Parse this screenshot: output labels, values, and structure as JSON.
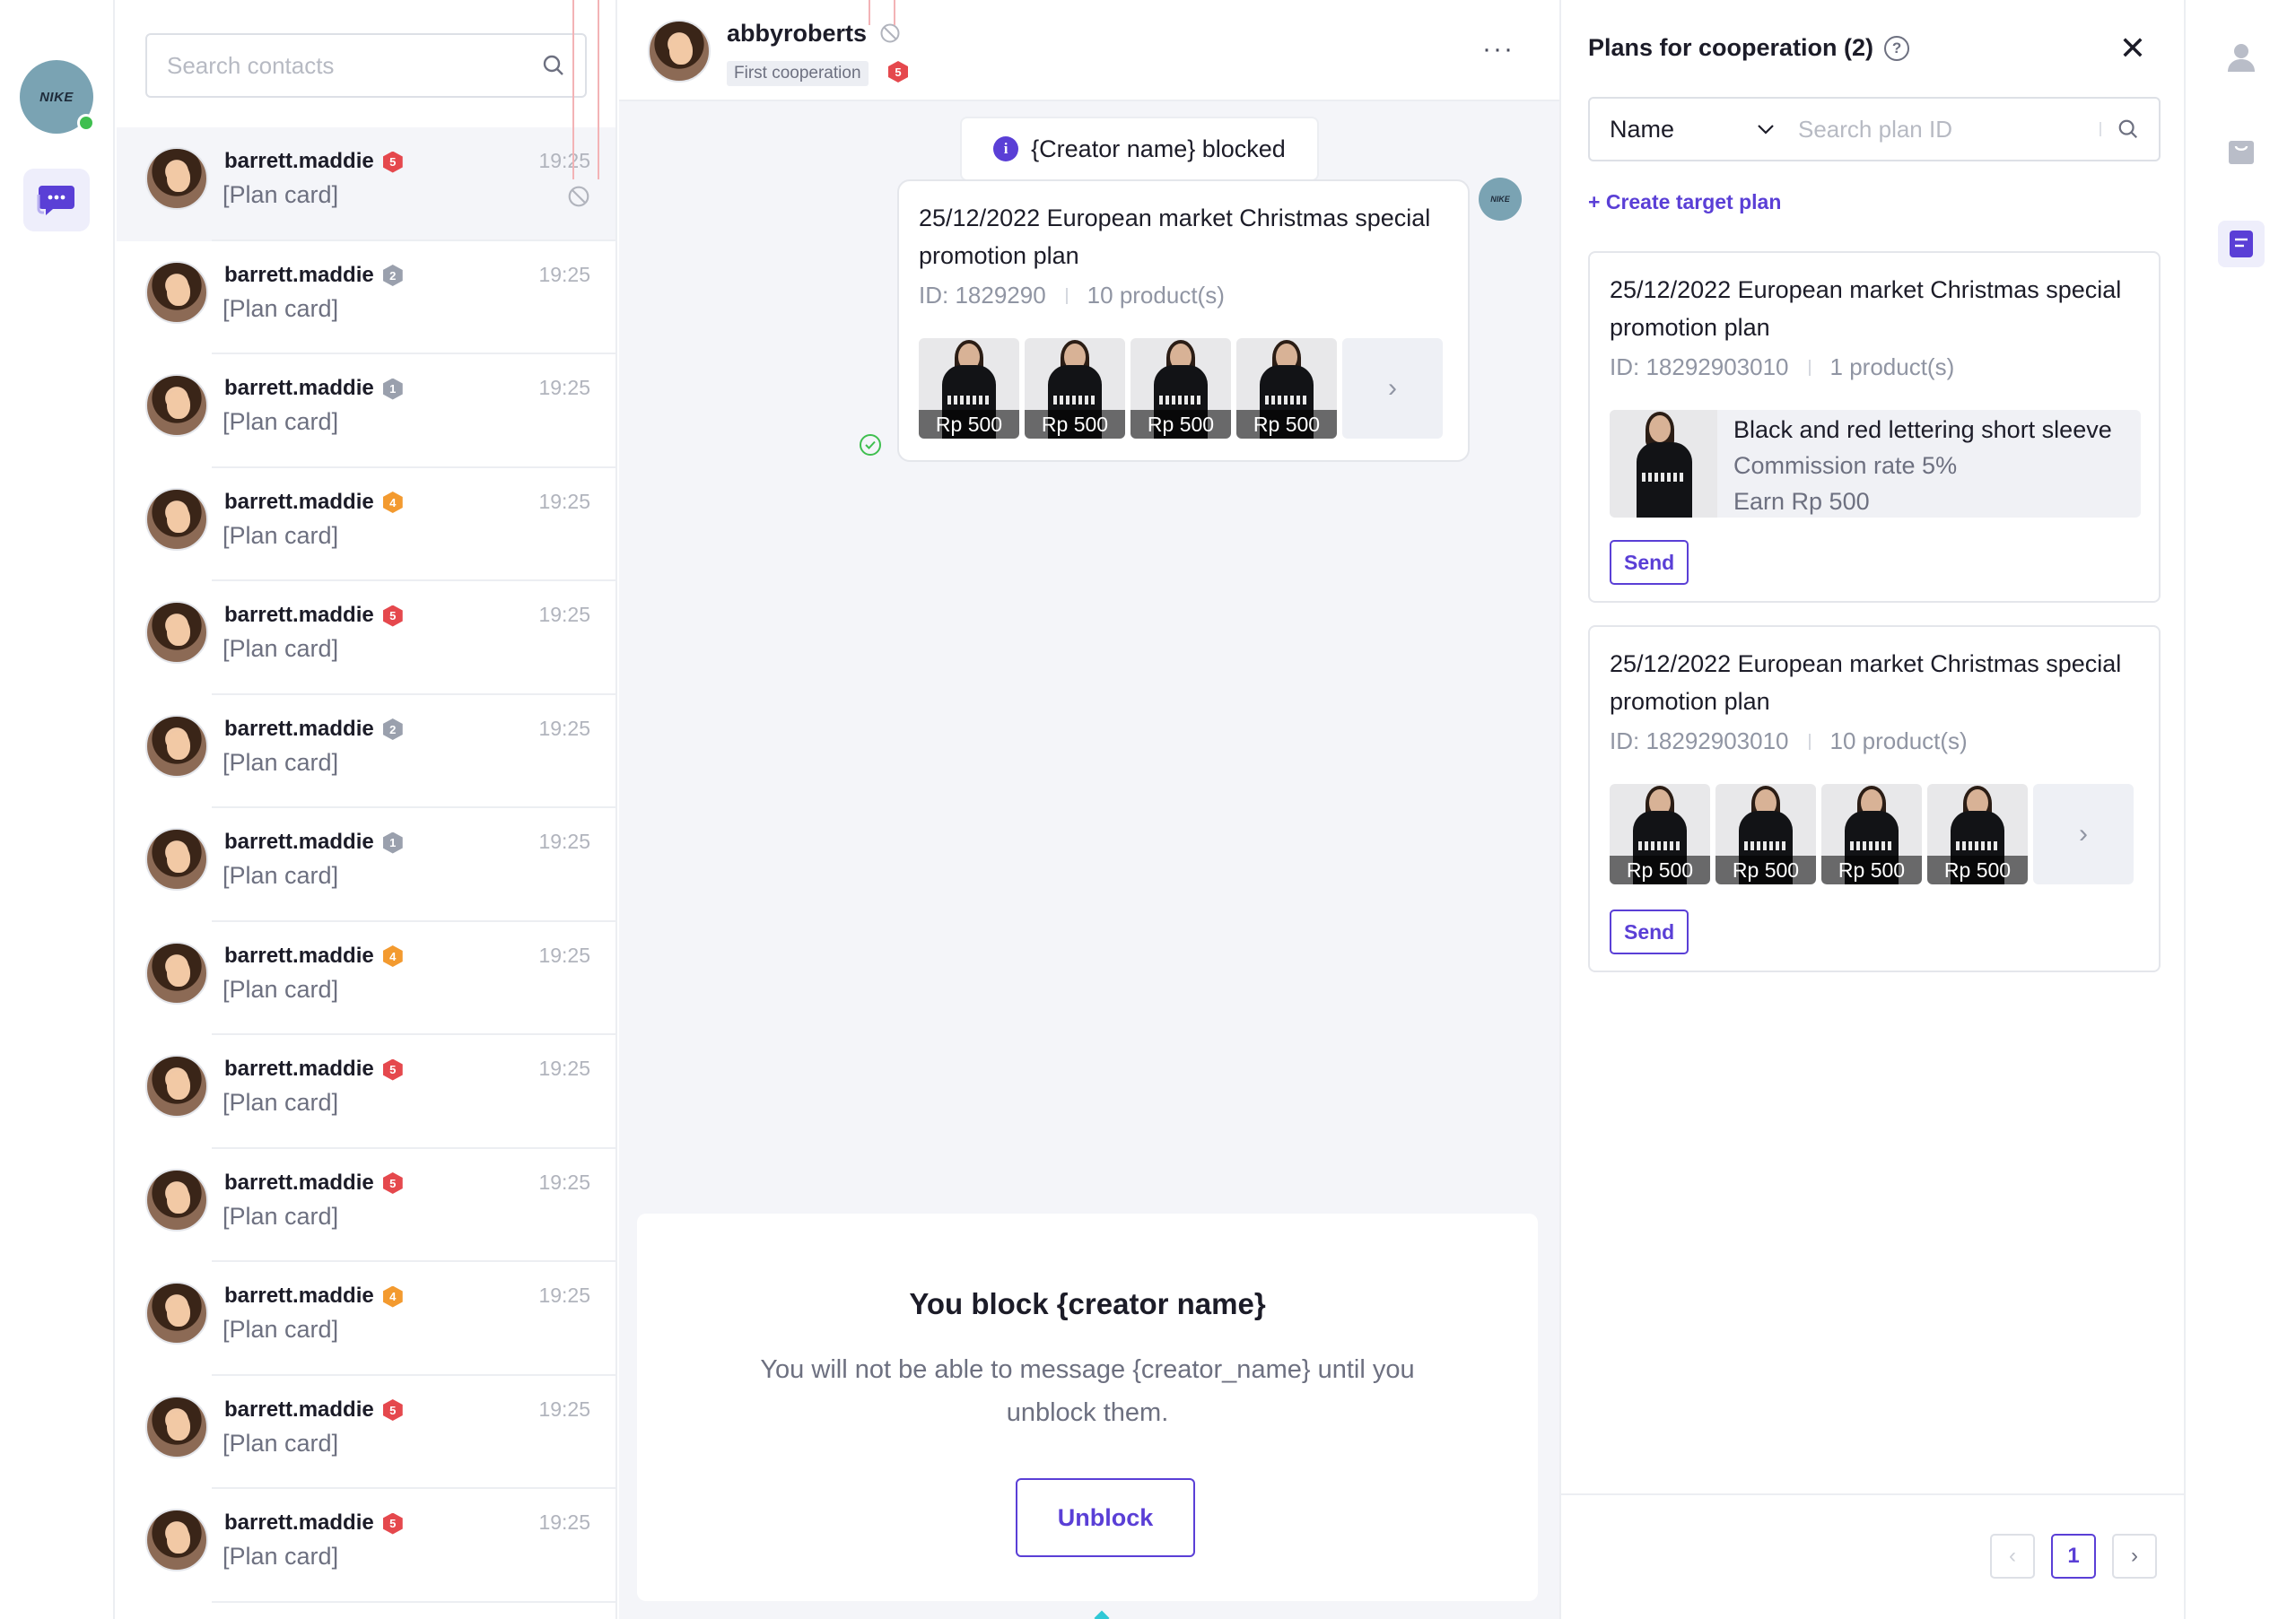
{
  "brand": {
    "logo_text": "NIKE",
    "status": "online"
  },
  "search": {
    "placeholder": "Search contacts"
  },
  "contacts": [
    {
      "name": "barrett.maddie",
      "level": "5",
      "level_color": "red",
      "preview": "[Plan card]",
      "time": "19:25",
      "blocked": true,
      "active": true
    },
    {
      "name": "barrett.maddie",
      "level": "2",
      "level_color": "gray",
      "preview": "[Plan card]",
      "time": "19:25"
    },
    {
      "name": "barrett.maddie",
      "level": "1",
      "level_color": "gray",
      "preview": "[Plan card]",
      "time": "19:25"
    },
    {
      "name": "barrett.maddie",
      "level": "4",
      "level_color": "orange",
      "preview": "[Plan card]",
      "time": "19:25"
    },
    {
      "name": "barrett.maddie",
      "level": "5",
      "level_color": "red",
      "preview": "[Plan card]",
      "time": "19:25"
    },
    {
      "name": "barrett.maddie",
      "level": "2",
      "level_color": "gray",
      "preview": "[Plan card]",
      "time": "19:25"
    },
    {
      "name": "barrett.maddie",
      "level": "1",
      "level_color": "gray",
      "preview": "[Plan card]",
      "time": "19:25"
    },
    {
      "name": "barrett.maddie",
      "level": "4",
      "level_color": "orange",
      "preview": "[Plan card]",
      "time": "19:25"
    },
    {
      "name": "barrett.maddie",
      "level": "5",
      "level_color": "red",
      "preview": "[Plan card]",
      "time": "19:25"
    },
    {
      "name": "barrett.maddie",
      "level": "5",
      "level_color": "red",
      "preview": "[Plan card]",
      "time": "19:25"
    },
    {
      "name": "barrett.maddie",
      "level": "4",
      "level_color": "orange",
      "preview": "[Plan card]",
      "time": "19:25"
    },
    {
      "name": "barrett.maddie",
      "level": "5",
      "level_color": "red",
      "preview": "[Plan card]",
      "time": "19:25"
    },
    {
      "name": "barrett.maddie",
      "level": "5",
      "level_color": "red",
      "preview": "[Plan card]",
      "time": "19:25"
    }
  ],
  "chat": {
    "name": "abbyroberts",
    "tag": "First cooperation",
    "level": "5",
    "more_label": "···",
    "notice": "{Creator name} blocked",
    "message": {
      "title": "25/12/2022 European market Christmas special promotion plan",
      "id_label": "ID: 1829290",
      "products_label": "10 product(s)",
      "prices": [
        "Rp 500",
        "Rp 500",
        "Rp 500",
        "Rp 500"
      ]
    },
    "sender_logo": "NIKE",
    "block_panel": {
      "title": "You block {creator name}",
      "description": "You will not be able to message {creator_name} until you unblock them.",
      "unblock_label": "Unblock"
    }
  },
  "plans": {
    "title": "Plans for cooperation (2)",
    "filter_select": "Name",
    "search_placeholder": "Search plan ID",
    "create_label": "Create target plan",
    "cards": [
      {
        "title": "25/12/2022 European market Christmas special promotion plan",
        "id_label": "ID: 18292903010",
        "products_label": "1 product(s)",
        "product": {
          "name": "Black and red lettering short sleeve",
          "commission": "Commission rate 5%",
          "earn": "Earn Rp 500"
        },
        "send_label": "Send"
      },
      {
        "title": "25/12/2022 European market Christmas special promotion plan",
        "id_label": "ID: 18292903010",
        "products_label": "10 product(s)",
        "prices": [
          "Rp 500",
          "Rp 500",
          "Rp 500",
          "Rp 500"
        ],
        "send_label": "Send"
      }
    ],
    "pagination": {
      "current": "1"
    }
  },
  "colors": {
    "accent": "#5a3fd6",
    "online": "#3fbf4f",
    "level_red": "#e5484d",
    "level_gray": "#9aa0ad",
    "level_orange": "#f39a2f"
  },
  "icons": {
    "rail": [
      "chat-icon"
    ],
    "right_rail": [
      "user-icon",
      "bag-icon",
      "document-icon"
    ]
  }
}
